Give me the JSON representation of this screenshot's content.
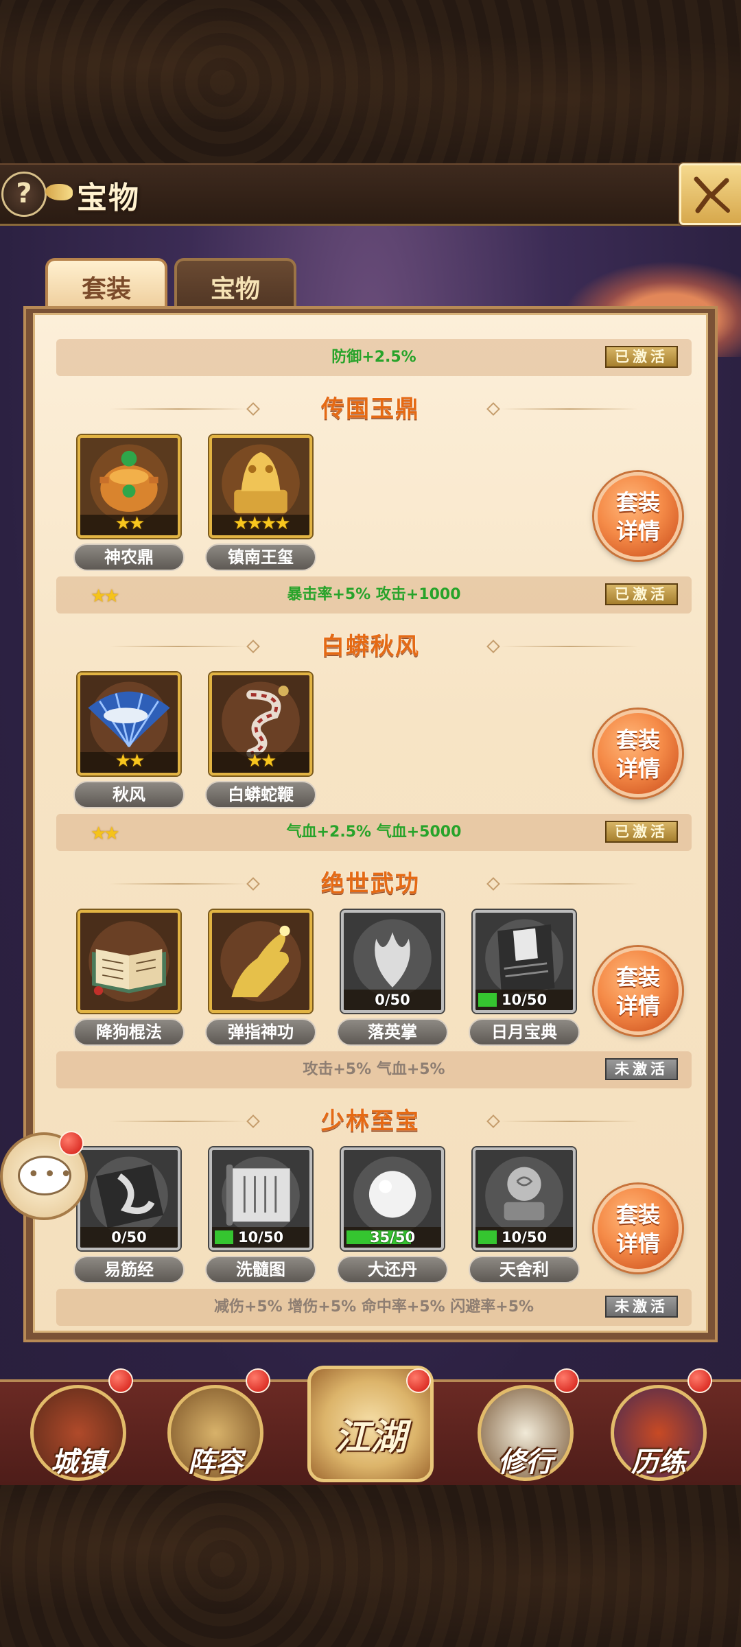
{
  "header": {
    "title": "宝物",
    "help_label": "?"
  },
  "tabs": [
    {
      "label": "套装",
      "selected": true
    },
    {
      "label": "宝物",
      "selected": false
    }
  ],
  "top_bar": {
    "effect": "防御+2.5%",
    "status": "已激活"
  },
  "detail_label_line1": "套装",
  "detail_label_line2": "详情",
  "sets": [
    {
      "title": "传国玉鼎",
      "items": [
        {
          "name": "神农鼎",
          "stars": "★★"
        },
        {
          "name": "镇南王玺",
          "stars": "★★★★"
        }
      ],
      "bar_stars": "★★",
      "effect": "暴击率+5%  攻击+1000",
      "status": "已激活"
    },
    {
      "title": "白蟒秋风",
      "items": [
        {
          "name": "秋风",
          "stars": "★★"
        },
        {
          "name": "白蟒蛇鞭",
          "stars": "★★"
        }
      ],
      "bar_stars": "★★",
      "effect": "气血+2.5%  气血+5000",
      "status": "已激活"
    },
    {
      "title": "绝世武功",
      "items": [
        {
          "name": "降狗棍法"
        },
        {
          "name": "弹指神功"
        },
        {
          "name": "落英掌",
          "progress": "0/50",
          "progress_value": 0
        },
        {
          "name": "日月宝典",
          "progress": "10/50",
          "progress_value": 0.2
        }
      ],
      "effect": "攻击+5%  气血+5%",
      "status": "未激活"
    },
    {
      "title": "少林至宝",
      "items": [
        {
          "name": "易筋经",
          "progress": "0/50",
          "progress_value": 0
        },
        {
          "name": "洗髓图",
          "progress": "10/50",
          "progress_value": 0.2
        },
        {
          "name": "大还丹",
          "progress": "35/50",
          "progress_value": 0.7
        },
        {
          "name": "天舍利",
          "progress": "10/50",
          "progress_value": 0.2
        }
      ],
      "effect": "减伤+5%  增伤+5%  命中率+5%  闪避率+5%",
      "status": "未激活"
    }
  ],
  "nav": [
    {
      "label": "城镇"
    },
    {
      "label": "阵容"
    },
    {
      "label": "江湖"
    },
    {
      "label": "修行"
    },
    {
      "label": "历练"
    }
  ],
  "colors": {
    "active_text": "#27a32a",
    "set_title": "#e56a14",
    "detail_button": "#f58b48"
  }
}
